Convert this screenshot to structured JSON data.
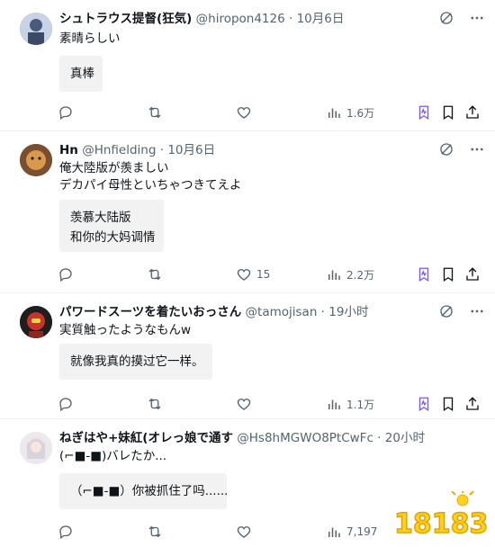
{
  "tweets": [
    {
      "name": "シュトラウス提督(狂気)",
      "handle": "@hiropon4126",
      "dot": "·",
      "time": "10月6日",
      "text": [
        "素晴らしい"
      ],
      "translation": [
        "真棒"
      ],
      "replies": "",
      "retweets": "",
      "likes": "",
      "views": "1.6万"
    },
    {
      "name": "Hn",
      "handle": "@Hnfielding",
      "dot": "·",
      "time": "10月6日",
      "text": [
        "俺大陸版が羨ましい",
        "デカパイ母性といちゃつきてえよ"
      ],
      "translation": [
        "羡慕大陆版",
        "和你的大妈调情"
      ],
      "replies": "",
      "retweets": "",
      "likes": "15",
      "views": "2.2万"
    },
    {
      "name": "パワードスーツを着たいおっさん",
      "handle": "@tamojisan",
      "dot": "·",
      "time": "19小时",
      "text": [
        "実質触ったようなもんw"
      ],
      "translation": [
        "就像我真的摸过它一样。"
      ],
      "replies": "",
      "retweets": "",
      "likes": "",
      "views": "1.1万"
    },
    {
      "name": "ねぎはや+妹紅(オレっ娘で通す",
      "handle": "@Hs8hMGWO8PtCwFc",
      "dot": "·",
      "time": "20小时",
      "text": [
        "(⌐■-■)バレたか..."
      ],
      "translation": [
        "（⌐■-■）你被抓住了吗......"
      ],
      "replies": "",
      "retweets": "",
      "likes": "",
      "views": "7,197"
    }
  ],
  "watermark": {
    "label": "18183"
  },
  "colors": {
    "text_primary": "#0f1419",
    "text_secondary": "#536471",
    "translation_bg": "#f2f2f2",
    "grok_purple": "#7856ff",
    "watermark_yellow": "#ffd21e"
  },
  "icons": [
    "reply-icon",
    "retweet-icon",
    "like-icon",
    "views-icon",
    "grok-icon",
    "bookmark-icon",
    "share-icon",
    "more-icon"
  ]
}
